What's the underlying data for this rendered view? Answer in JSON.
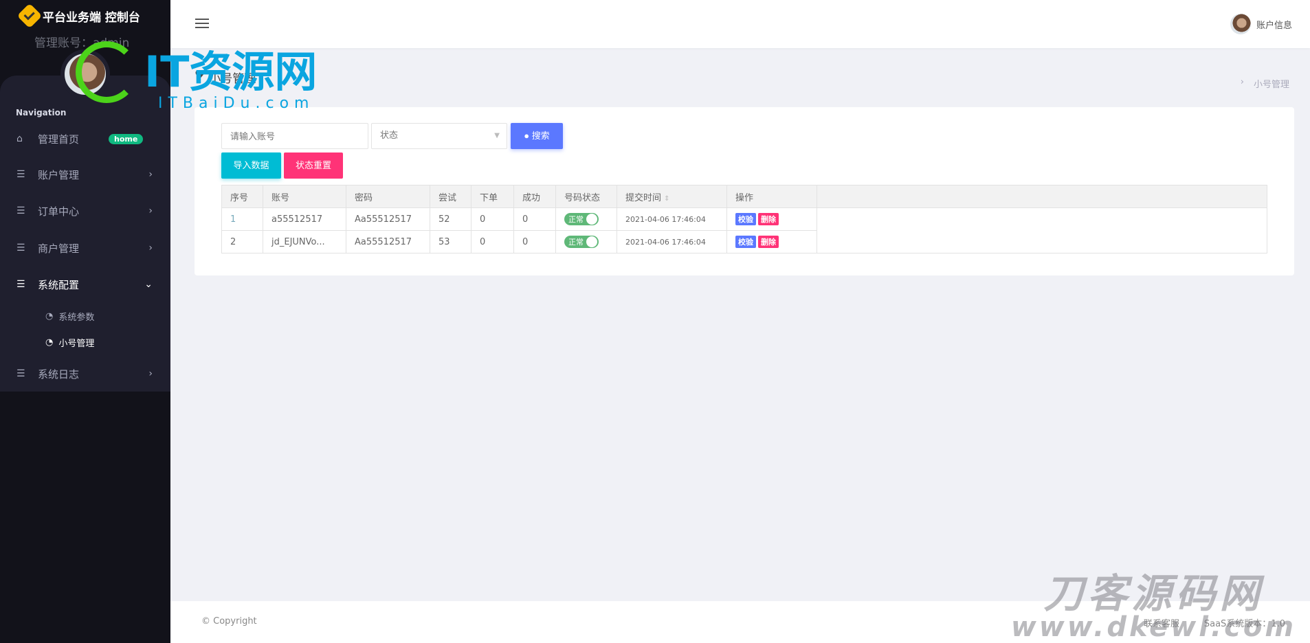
{
  "app": {
    "brand": "平台业务端 控制台",
    "admin_label": "管理账号：admin",
    "nav_heading": "Navigation"
  },
  "sidebar": {
    "items": [
      {
        "label": "管理首页",
        "icon": "home-icon",
        "badge": "home"
      },
      {
        "label": "账户管理",
        "icon": "list-icon"
      },
      {
        "label": "订单中心",
        "icon": "list-icon"
      },
      {
        "label": "商户管理",
        "icon": "list-icon"
      },
      {
        "label": "系统配置",
        "icon": "list-icon",
        "expanded": true
      },
      {
        "label": "系统日志",
        "icon": "list-icon"
      }
    ],
    "subitems": [
      {
        "label": "系统参数"
      },
      {
        "label": "小号管理",
        "active": true
      }
    ]
  },
  "header": {
    "account": "账户信息"
  },
  "page": {
    "title": "小号管理",
    "breadcrumb": "小号管理"
  },
  "search": {
    "account_placeholder": "请输入账号",
    "status_placeholder": "状态",
    "search_label": "搜索",
    "import_label": "导入数据",
    "reset_label": "状态重置"
  },
  "table": {
    "columns": [
      "序号",
      "账号",
      "密码",
      "尝试",
      "下单",
      "成功",
      "号码状态",
      "提交时间",
      "操作"
    ],
    "rows": [
      {
        "no": "1",
        "account": "a55512517",
        "password": "Aa55512517",
        "tries": "52",
        "orders": "0",
        "success": "0",
        "status": "正常",
        "time": "2021-04-06 17:46:04"
      },
      {
        "no": "2",
        "account": "jd_EJUNVo...",
        "password": "Aa55512517",
        "tries": "53",
        "orders": "0",
        "success": "0",
        "status": "正常",
        "time": "2021-04-06 17:46:04"
      }
    ],
    "actions": {
      "verify": "校验",
      "delete": "删除"
    }
  },
  "footer": {
    "copyright": "© Copyright",
    "contact": "联系客服",
    "version": "SaaS系统版本：1.0"
  },
  "watermarks": {
    "wm1": "IT资源网",
    "wm1_sub": "ITBaiDu.com",
    "wm2": "刀客源码网",
    "wm2_sub": "www.dkewl.com"
  },
  "colors": {
    "primary": "#5b78ff",
    "cyan": "#00bcd4",
    "pink": "#ff3377",
    "green": "#5fb878",
    "badge": "#10b981"
  }
}
